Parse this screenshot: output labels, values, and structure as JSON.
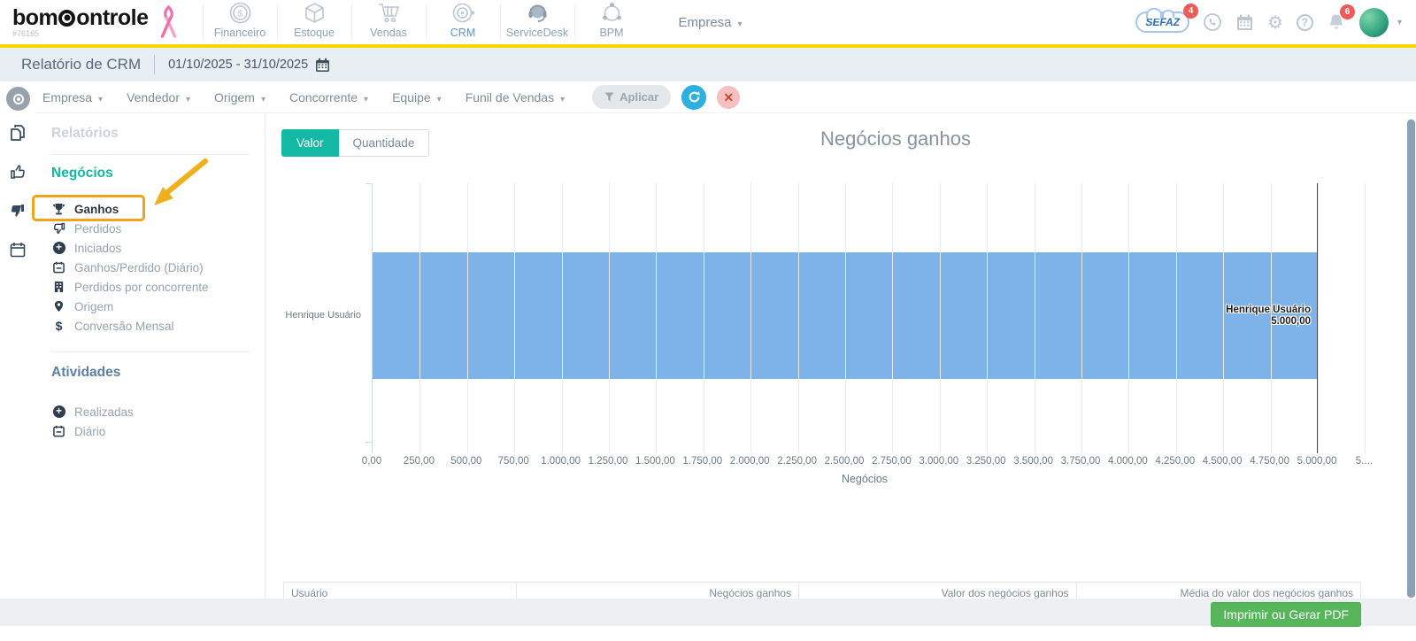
{
  "topnav": {
    "logo_prefix": "bom",
    "logo_suffix": "ontrole",
    "account_id": "#76165",
    "modules": [
      {
        "label": "Financeiro",
        "icon": "coin-icon"
      },
      {
        "label": "Estoque",
        "icon": "cube-icon"
      },
      {
        "label": "Vendas",
        "icon": "cart-icon"
      },
      {
        "label": "CRM",
        "icon": "target-icon"
      },
      {
        "label": "ServiceDesk",
        "icon": "headset-icon"
      },
      {
        "label": "BPM",
        "icon": "bpm-icon"
      }
    ],
    "company_selector": "Empresa",
    "sefaz": {
      "label": "SEFAZ",
      "badge": "4"
    },
    "notifications_badge": "6"
  },
  "titlebar": {
    "title": "Relatório de CRM",
    "date_range": "01/10/2025 - 31/10/2025"
  },
  "filters": {
    "dropdowns": [
      "Empresa",
      "Vendedor",
      "Origem",
      "Concorrente",
      "Equipe",
      "Funil de Vendas"
    ],
    "apply_label": "Aplicar"
  },
  "sidebar": {
    "relatorios_heading": "Relatórios",
    "negocios": {
      "heading": "Negócios",
      "items": [
        {
          "label": "Ganhos",
          "icon": "trophy-icon",
          "active": true
        },
        {
          "label": "Perdidos",
          "icon": "thumbs-down-icon"
        },
        {
          "label": "Iniciados",
          "icon": "plus-circle-icon"
        },
        {
          "label": "Ganhos/Perdido (Diário)",
          "icon": "calendar-icon"
        },
        {
          "label": "Perdidos por concorrente",
          "icon": "building-icon"
        },
        {
          "label": "Origem",
          "icon": "map-pin-icon"
        },
        {
          "label": "Conversão Mensal",
          "icon": "dollar-icon"
        }
      ]
    },
    "atividades": {
      "heading": "Atividades",
      "items": [
        {
          "label": "Realizadas",
          "icon": "plus-circle-icon"
        },
        {
          "label": "Diário",
          "icon": "calendar-icon"
        }
      ]
    }
  },
  "main": {
    "toggle": {
      "valor": "Valor",
      "quantidade": "Quantidade"
    }
  },
  "chart_data": {
    "type": "bar",
    "orientation": "horizontal",
    "title": "Negócios ganhos",
    "categories": [
      "Henrique Usuário"
    ],
    "values": [
      5000
    ],
    "data_label": {
      "line1": "Henrique Usuário",
      "line2": "5.000,00"
    },
    "xlabel": "Negócios",
    "xlim": [
      0,
      5250
    ],
    "tick_step": 250,
    "x_ticks": [
      "0,00",
      "250,00",
      "500,00",
      "750,00",
      "1.000,00",
      "1.250,00",
      "1.500,00",
      "1.750,00",
      "2.000,00",
      "2.250,00",
      "2.500,00",
      "2.750,00",
      "3.000,00",
      "3.250,00",
      "3.500,00",
      "3.750,00",
      "4.000,00",
      "4.250,00",
      "4.500,00",
      "4.750,00",
      "5.000,00",
      "5...."
    ],
    "bar_color": "#7db3e8",
    "marker_value": 5000,
    "grid": true,
    "legend": false
  },
  "table": {
    "columns": [
      "Usuário",
      "Negócios ganhos",
      "Valor dos negócios ganhos",
      "Média do valor dos negócios ganhos"
    ]
  },
  "footer": {
    "print_button_label": "Imprimir ou Gerar PDF"
  },
  "colors": {
    "accent_teal": "#14b9a6",
    "highlight_orange": "#efa41e",
    "bar_blue": "#7db3e8",
    "header_yellow": "#f8d600",
    "button_green": "#57b65b",
    "badge_red": "#f05b57"
  }
}
